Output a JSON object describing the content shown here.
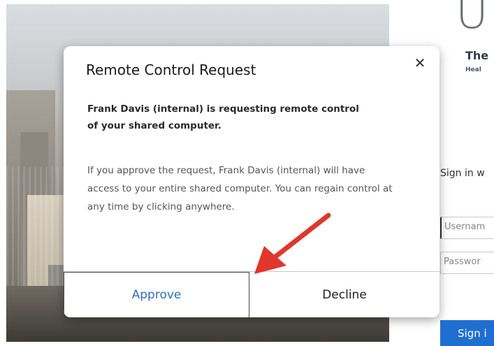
{
  "background": {
    "org_logo_letter": "U",
    "org_name": "The",
    "org_subtitle": "Heal",
    "signin_heading": "Sign in w",
    "username_placeholder": "Usernam",
    "password_placeholder": "Passwor",
    "signin_button_label": "Sign i",
    "signin_button_color": "#1f6fd1"
  },
  "dialog": {
    "title": "Remote Control Request",
    "close_icon": "close-icon",
    "bold_message": "Frank Davis (internal) is requesting remote control of your shared computer.",
    "body_message": "If you approve the request, Frank Davis (internal) will have access to your entire shared computer. You can regain control at any time by clicking anywhere.",
    "approve_label": "Approve",
    "decline_label": "Decline",
    "approve_color": "#2f6fb5"
  },
  "annotation": {
    "arrow_color": "#e0362c"
  }
}
